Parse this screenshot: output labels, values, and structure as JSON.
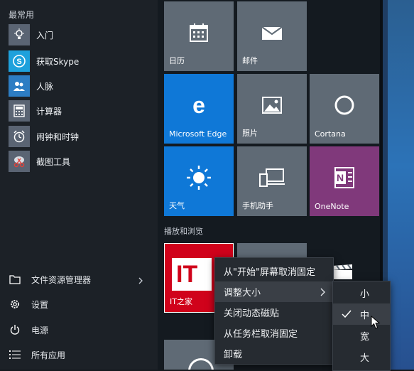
{
  "start_menu": {
    "most_used_title": "最常用",
    "most_used": [
      {
        "label": "入门",
        "icon": "lightbulb-icon",
        "color": "#5a6473"
      },
      {
        "label": "获取Skype",
        "icon": "skype-icon",
        "color": "#1ea1dc"
      },
      {
        "label": "人脉",
        "icon": "people-icon",
        "color": "#2d7dc3"
      },
      {
        "label": "计算器",
        "icon": "calculator-icon",
        "color": "#5a6473"
      },
      {
        "label": "闹钟和时钟",
        "icon": "alarm-clock-icon",
        "color": "#5a6473"
      },
      {
        "label": "截图工具",
        "icon": "snipping-tool-icon",
        "color": "#5a6473"
      }
    ],
    "system": {
      "file_explorer": "文件资源管理器",
      "settings": "设置",
      "power": "电源",
      "all_apps": "所有应用"
    }
  },
  "tiles": {
    "calendar": "日历",
    "mail": "邮件",
    "edge": "Microsoft Edge",
    "photos": "照片",
    "cortana": "Cortana",
    "weather": "天气",
    "phone": "手机助手",
    "onenote": "OneNote",
    "group_title": "播放和浏览",
    "ithome": "IT之家",
    "ithome_logo": "IT"
  },
  "context_menu": {
    "items": [
      {
        "label": "从\"开始\"屏幕取消固定"
      },
      {
        "label": "调整大小",
        "has_submenu": true
      },
      {
        "label": "关闭动态磁贴"
      },
      {
        "label": "从任务栏取消固定"
      },
      {
        "label": "卸载"
      }
    ],
    "hovered_index": 1
  },
  "resize_submenu": {
    "items": [
      "小",
      "中",
      "宽",
      "大"
    ],
    "selected": "中"
  },
  "colors": {
    "tile_gray": "#5f6a75",
    "tile_blue": "#0f78d7",
    "tile_purple": "#80397b",
    "tile_red": "#d0021b",
    "menu_bg": "#262b31"
  }
}
